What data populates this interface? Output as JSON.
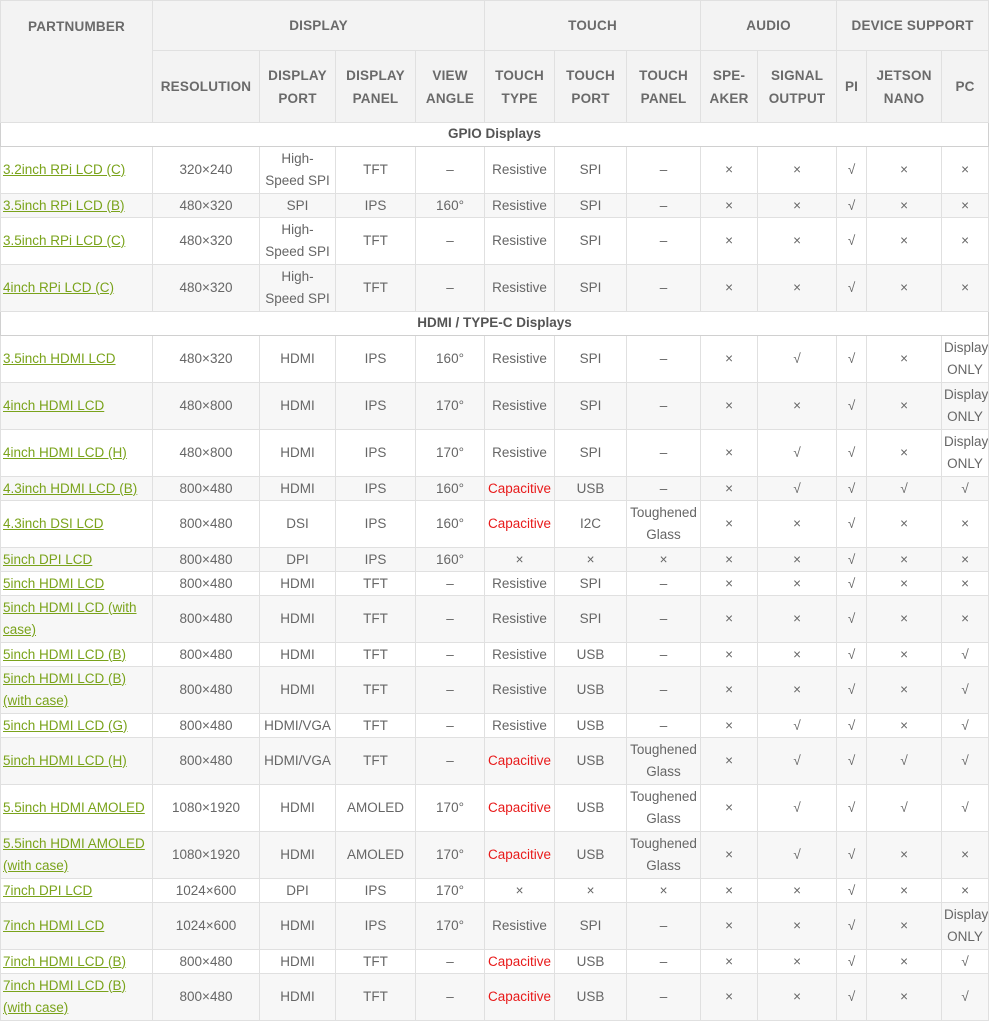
{
  "header": {
    "partnumber": "PARTNUMBER",
    "groups": [
      "DISPLAY",
      "TOUCH",
      "AUDIO",
      "DEVICE SUPPORT"
    ],
    "columns": [
      [
        "RESOLUTION"
      ],
      [
        "DISPLAY",
        "PORT"
      ],
      [
        "DISPLAY",
        "PANEL"
      ],
      [
        "VIEW",
        "ANGLE"
      ],
      [
        "TOUCH",
        "TYPE"
      ],
      [
        "TOUCH",
        "PORT"
      ],
      [
        "TOUCH",
        "PANEL"
      ],
      [
        "SPE-",
        "AKER"
      ],
      [
        "SIGNAL",
        "OUTPUT"
      ],
      [
        "PI"
      ],
      [
        "JETSON",
        "NANO"
      ],
      [
        "PC"
      ]
    ]
  },
  "sections": [
    {
      "title": "GPIO Displays",
      "rows": [
        {
          "h": 2,
          "cells": [
            "3.2inch RPi LCD (C)",
            "320×240",
            "High-Speed SPI",
            "TFT",
            "–",
            "Resistive",
            "SPI",
            "–",
            "×",
            "×",
            "√",
            "×",
            "×"
          ]
        },
        {
          "h": 1,
          "cells": [
            "3.5inch RPi LCD (B)",
            "480×320",
            "SPI",
            "IPS",
            "160°",
            "Resistive",
            "SPI",
            "–",
            "×",
            "×",
            "√",
            "×",
            "×"
          ]
        },
        {
          "h": 2,
          "cells": [
            "3.5inch RPi LCD (C)",
            "480×320",
            "High-Speed SPI",
            "TFT",
            "–",
            "Resistive",
            "SPI",
            "–",
            "×",
            "×",
            "√",
            "×",
            "×"
          ]
        },
        {
          "h": 2,
          "cells": [
            "4inch RPi LCD (C)",
            "480×320",
            "High-Speed SPI",
            "TFT",
            "–",
            "Resistive",
            "SPI",
            "–",
            "×",
            "×",
            "√",
            "×",
            "×"
          ]
        }
      ]
    },
    {
      "title": "HDMI / TYPE-C Displays",
      "rows": [
        {
          "h": 2,
          "cells": [
            "3.5inch HDMI LCD",
            "480×320",
            "HDMI",
            "IPS",
            "160°",
            "Resistive",
            "SPI",
            "–",
            "×",
            "√",
            "√",
            "×",
            "Display ONLY"
          ]
        },
        {
          "h": 2,
          "cells": [
            "4inch HDMI LCD",
            "480×800",
            "HDMI",
            "IPS",
            "170°",
            "Resistive",
            "SPI",
            "–",
            "×",
            "×",
            "√",
            "×",
            "Display ONLY"
          ]
        },
        {
          "h": 2,
          "cells": [
            "4inch HDMI LCD (H)",
            "480×800",
            "HDMI",
            "IPS",
            "170°",
            "Resistive",
            "SPI",
            "–",
            "×",
            "√",
            "√",
            "×",
            "Display ONLY"
          ]
        },
        {
          "h": 1,
          "cells": [
            "4.3inch HDMI LCD (B)",
            "800×480",
            "HDMI",
            "IPS",
            "160°",
            "Capacitive",
            "USB",
            "–",
            "×",
            "√",
            "√",
            "√",
            "√"
          ]
        },
        {
          "h": 2,
          "cells": [
            "4.3inch DSI LCD",
            "800×480",
            "DSI",
            "IPS",
            "160°",
            "Capacitive",
            "I2C",
            "Toughened Glass",
            "×",
            "×",
            "√",
            "×",
            "×"
          ]
        },
        {
          "h": 1,
          "cells": [
            "5inch DPI LCD",
            "800×480",
            "DPI",
            "IPS",
            "160°",
            "×",
            "×",
            "×",
            "×",
            "×",
            "√",
            "×",
            "×"
          ]
        },
        {
          "h": 1,
          "cells": [
            "5inch HDMI LCD",
            "800×480",
            "HDMI",
            "TFT",
            "–",
            "Resistive",
            "SPI",
            "–",
            "×",
            "×",
            "√",
            "×",
            "×"
          ]
        },
        {
          "h": 2,
          "cells": [
            "5inch HDMI LCD (with case)",
            "800×480",
            "HDMI",
            "TFT",
            "–",
            "Resistive",
            "SPI",
            "–",
            "×",
            "×",
            "√",
            "×",
            "×"
          ]
        },
        {
          "h": 1,
          "cells": [
            "5inch HDMI LCD (B)",
            "800×480",
            "HDMI",
            "TFT",
            "–",
            "Resistive",
            "USB",
            "–",
            "×",
            "×",
            "√",
            "×",
            "√"
          ]
        },
        {
          "h": 2,
          "cells": [
            "5inch HDMI LCD (B) (with case)",
            "800×480",
            "HDMI",
            "TFT",
            "–",
            "Resistive",
            "USB",
            "–",
            "×",
            "×",
            "√",
            "×",
            "√"
          ]
        },
        {
          "h": 1,
          "cells": [
            "5inch HDMI LCD (G)",
            "800×480",
            "HDMI/VGA",
            "TFT",
            "–",
            "Resistive",
            "USB",
            "–",
            "×",
            "√",
            "√",
            "×",
            "√"
          ]
        },
        {
          "h": 2,
          "cells": [
            "5inch HDMI LCD (H)",
            "800×480",
            "HDMI/VGA",
            "TFT",
            "–",
            "Capacitive",
            "USB",
            "Toughened Glass",
            "×",
            "√",
            "√",
            "√",
            "√"
          ]
        },
        {
          "h": 2,
          "cells": [
            "5.5inch HDMI AMOLED",
            "1080×1920",
            "HDMI",
            "AMOLED",
            "170°",
            "Capacitive",
            "USB",
            "Toughened Glass",
            "×",
            "√",
            "√",
            "√",
            "√"
          ]
        },
        {
          "h": 2,
          "cells": [
            "5.5inch HDMI AMOLED (with case)",
            "1080×1920",
            "HDMI",
            "AMOLED",
            "170°",
            "Capacitive",
            "USB",
            "Toughened Glass",
            "×",
            "√",
            "√",
            "×",
            "×"
          ]
        },
        {
          "h": 1,
          "cells": [
            "7inch DPI LCD",
            "1024×600",
            "DPI",
            "IPS",
            "170°",
            "×",
            "×",
            "×",
            "×",
            "×",
            "√",
            "×",
            "×"
          ]
        },
        {
          "h": 2,
          "cells": [
            "7inch HDMI LCD",
            "1024×600",
            "HDMI",
            "IPS",
            "170°",
            "Resistive",
            "SPI",
            "–",
            "×",
            "×",
            "√",
            "×",
            "Display ONLY"
          ]
        },
        {
          "h": 1,
          "cells": [
            "7inch HDMI LCD (B)",
            "800×480",
            "HDMI",
            "TFT",
            "–",
            "Capacitive",
            "USB",
            "–",
            "×",
            "×",
            "√",
            "×",
            "√"
          ]
        },
        {
          "h": 2,
          "cells": [
            "7inch HDMI LCD (B) (with case)",
            "800×480",
            "HDMI",
            "TFT",
            "–",
            "Capacitive",
            "USB",
            "–",
            "×",
            "×",
            "√",
            "×",
            "√"
          ]
        }
      ]
    }
  ],
  "colors": {
    "link": "#7aa31b",
    "capacitive": "#e81a1a",
    "header_bg": "#f3f3f3",
    "alt_row_bg": "#f7f7f7"
  }
}
